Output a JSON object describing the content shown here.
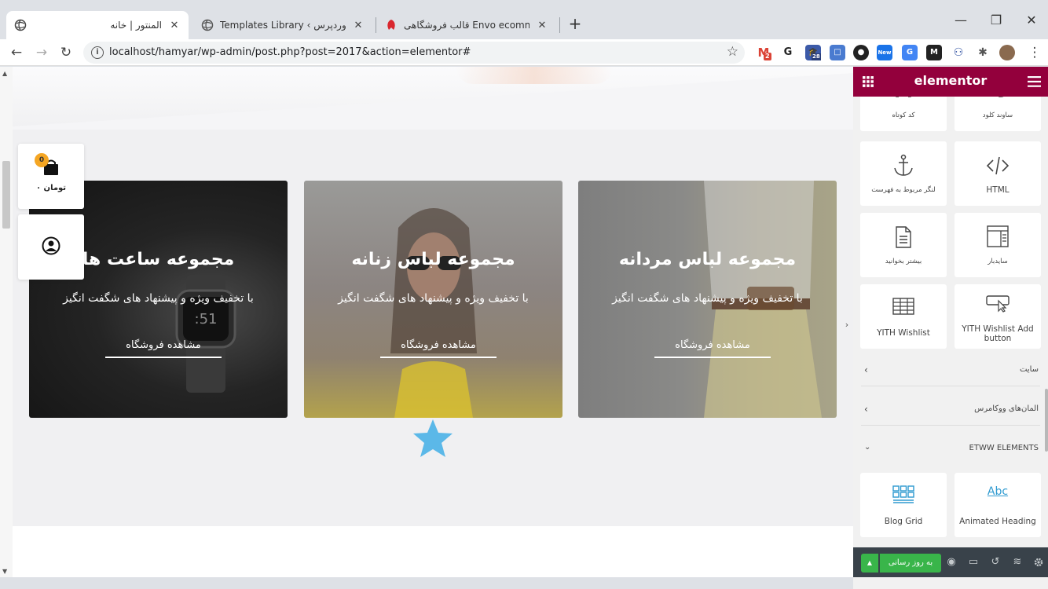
{
  "browser": {
    "tabs": [
      {
        "title": "المنتور | خانه",
        "active": true,
        "favicon": "globe-icon"
      },
      {
        "title": "Templates Library ‹ س — وردپرس",
        "active": false,
        "favicon": "globe-icon"
      },
      {
        "title": "قالب فروشگاهی Envo ecommerce",
        "active": false,
        "favicon": "red-logo-icon"
      }
    ],
    "new_tab": "+",
    "window_controls": {
      "minimize": "—",
      "restore": "❐",
      "close": "✕"
    },
    "url": "localhost/hamyar/wp-admin/post.php?post=2017&action=elementor#",
    "extensions": [
      {
        "name": "gmail-extension-icon",
        "badge": "2",
        "color": "#db4437"
      },
      {
        "name": "circle-c-extension-icon",
        "badge": "",
        "color": "#222222"
      },
      {
        "name": "cap-extension-icon",
        "badge": "28",
        "color": "#3c5aa8"
      },
      {
        "name": "blue-square-extension-icon",
        "badge": "",
        "color": "#4a7bd0"
      },
      {
        "name": "github-extension-icon",
        "badge": "",
        "color": "#222222"
      },
      {
        "name": "new-extension-icon",
        "badge": "New",
        "color": "#1a73e8"
      },
      {
        "name": "translate-extension-icon",
        "badge": "",
        "color": "#4285f4"
      },
      {
        "name": "m-extension-icon",
        "badge": "",
        "color": "#222222"
      },
      {
        "name": "person-extension-icon",
        "badge": "",
        "color": "#2d4fa0"
      },
      {
        "name": "puzzle-extension-icon",
        "badge": "",
        "color": "#555555"
      }
    ]
  },
  "canvas": {
    "cart": {
      "count": "0",
      "total": "۰ تومان"
    },
    "cards": [
      {
        "title": "مجموعه ساعت ها",
        "subtitle": "با تخفیف ویژه و پیشنهاد های شگفت انگیز",
        "link": "مشاهده فروشگاه"
      },
      {
        "title": "مجموعه لباس زنانه",
        "subtitle": "با تخفیف ویژه و پیشنهاد های شگفت انگیز",
        "link": "مشاهده فروشگاه"
      },
      {
        "title": "مجموعه لباس مردانه",
        "subtitle": "با تخفیف ویژه و پیشنهاد های شگفت انگیز",
        "link": "مشاهده فروشگاه"
      }
    ],
    "star_color": "#5bb8e8"
  },
  "panel": {
    "logo": "elementor",
    "brand_color": "#93003c",
    "partial_widgets": [
      {
        "label": "کد کوتاه"
      },
      {
        "label": "ساوند کلود"
      }
    ],
    "widgets": [
      {
        "label": "لنگر مربوط به فهرست",
        "icon": "anchor-icon"
      },
      {
        "label": "HTML",
        "icon": "code-icon"
      },
      {
        "label": "بیشتر بخوانید",
        "icon": "read-more-icon"
      },
      {
        "label": "سایدبار",
        "icon": "sidebar-icon"
      },
      {
        "label": "YITH Wishlist",
        "icon": "wishlist-table-icon"
      },
      {
        "label": "YITH Wishlist Add button",
        "icon": "wishlist-button-icon"
      }
    ],
    "categories": [
      {
        "label": "سایت",
        "open": false
      },
      {
        "label": "المان‌های ووکامرس",
        "open": false
      },
      {
        "label": "ETWW ELEMENTS",
        "open": true
      }
    ],
    "etww_widgets": [
      {
        "label": "Blog Grid",
        "icon": "blog-grid-icon"
      },
      {
        "label": "Animated Heading",
        "icon": "animated-heading-icon",
        "icon_text": "Abc"
      }
    ],
    "footer": {
      "update_label": "به روز رسانی"
    }
  }
}
